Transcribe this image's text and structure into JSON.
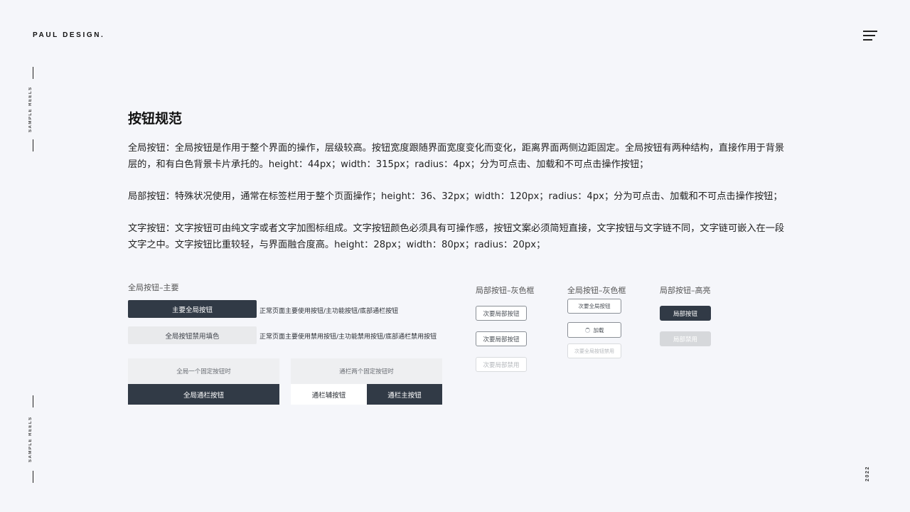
{
  "header": {
    "brand": "PAUL DESIGN."
  },
  "sidebar": {
    "top_text": "SAMPLE REELS",
    "bottom_text": "SAMPLE REELS"
  },
  "footer": {
    "year": "2022"
  },
  "main": {
    "title": "按钮规范",
    "paragraphs": [
      "全局按钮：全局按钮是作用于整个界面的操作，层级较高。按钮宽度跟随界面宽度变化而变化，距离界面两侧边距固定。全局按钮有两种结构，直接作用于背景层的，和有白色背景卡片承托的。height：44px；width：315px；radius：4px；分为可点击、加载和不可点击操作按钮；",
      "局部按钮：特殊状况使用，通常在标签栏用于整个页面操作；height：36、32px；width：120px；radius：4px；分为可点击、加载和不可点击操作按钮；",
      "文字按钮：文字按钮可由纯文字或者文字加图标组成。文字按钮颜色必须具有可操作感，按钮文案必须简短直接，文字按钮与文字链不同，文字链可嵌入在一段文字之中。文字按钮比重较轻，与界面融合度高。height：28px；width：80px；radius：20px；"
    ]
  },
  "global_section": {
    "label": "全局按钮–主要",
    "primary_button": "主要全局按钮",
    "primary_note": "正常页面主要使用按钮/主功能按钮/底部通栏按钮",
    "disabled_button": "全局按钮禁用填色",
    "disabled_note": "正常页面主要使用禁用按钮/主功能禁用按钮/底部通栏禁用按钮",
    "fixed_one_caption": "全局一个固定按钮时",
    "fixed_one_button": "全局通栏按钮",
    "fixed_two_caption": "通栏两个固定按钮时",
    "fixed_two_secondary": "通栏辅按钮",
    "fixed_two_primary": "通栏主按钮"
  },
  "local_gray": {
    "label": "局部按钮–灰色框",
    "buttons": [
      "次要局部按钮",
      "次要局部按钮",
      "次要局部禁用"
    ]
  },
  "global_gray": {
    "label": "全局按钮–灰色框",
    "normal": "次要全局按钮",
    "loading": "加载",
    "disabled": "次要全局按钮禁用"
  },
  "local_highlight": {
    "label": "局部按钮–高亮",
    "normal": "局部按钮",
    "disabled": "局部禁用"
  },
  "colors": {
    "background": "#f5f6fa",
    "primary_dark": "#313a46",
    "disabled_fill": "#e9eaec",
    "highlight_disabled": "#d6d8db"
  }
}
